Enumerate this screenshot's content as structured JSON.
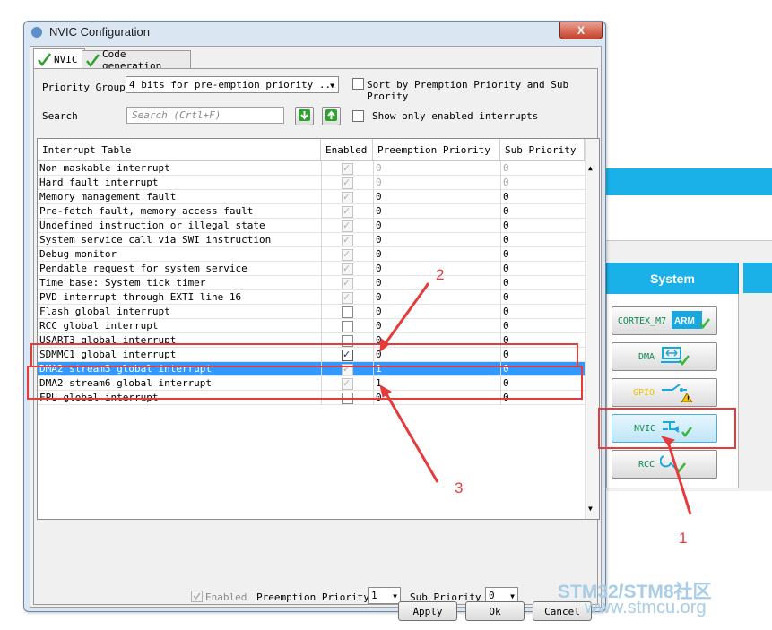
{
  "dialog": {
    "title": "NVIC Configuration",
    "close_label": "X",
    "tabs": [
      {
        "label": "NVIC"
      },
      {
        "label": "Code generation"
      }
    ],
    "priority_group": {
      "label": "Priority Group",
      "value": "4 bits for pre-emption priority ..."
    },
    "sort_checkbox_label": "Sort by Premption Priority and Sub Prority",
    "search": {
      "label": "Search",
      "placeholder": "Search (Crtl+F)"
    },
    "show_enabled_label": "Show only enabled interrupts",
    "table": {
      "headers": [
        "Interrupt Table",
        "Enabled",
        "Preemption Priority",
        "Sub Priority"
      ],
      "rows": [
        {
          "name": "Non maskable interrupt",
          "preemption": "0",
          "sub": "0"
        },
        {
          "name": "Hard fault interrupt",
          "preemption": "0",
          "sub": "0"
        },
        {
          "name": "Memory management fault",
          "preemption": "0",
          "sub": "0"
        },
        {
          "name": "Pre-fetch fault, memory access fault",
          "preemption": "0",
          "sub": "0"
        },
        {
          "name": "Undefined instruction or illegal state",
          "preemption": "0",
          "sub": "0"
        },
        {
          "name": "System service call via SWI instruction",
          "preemption": "0",
          "sub": "0"
        },
        {
          "name": "Debug monitor",
          "preemption": "0",
          "sub": "0"
        },
        {
          "name": "Pendable request for system service",
          "preemption": "0",
          "sub": "0"
        },
        {
          "name": "Time base: System tick timer",
          "preemption": "0",
          "sub": "0"
        },
        {
          "name": "PVD interrupt through EXTI line 16",
          "preemption": "0",
          "sub": "0"
        },
        {
          "name": "Flash global interrupt",
          "preemption": "0",
          "sub": "0"
        },
        {
          "name": "RCC global interrupt",
          "preemption": "0",
          "sub": "0"
        },
        {
          "name": "USART3 global interrupt",
          "preemption": "0",
          "sub": "0"
        },
        {
          "name": "SDMMC1 global interrupt",
          "preemption": "0",
          "sub": "0"
        },
        {
          "name": "DMA2 stream3 global interrupt",
          "preemption": "1",
          "sub": "0"
        },
        {
          "name": "DMA2 stream6 global interrupt",
          "preemption": "1",
          "sub": "0"
        },
        {
          "name": "FPU global interrupt",
          "preemption": "0",
          "sub": "0"
        }
      ]
    },
    "bottom": {
      "enabled_label": "Enabled",
      "preemption_label": "Preemption Priority",
      "preemption_value": "1",
      "sub_label": "Sub Priority",
      "sub_value": "0"
    },
    "buttons": {
      "apply": "Apply",
      "ok": "Ok",
      "cancel": "Cancel"
    }
  },
  "background_panel": {
    "section_title": "System",
    "buttons": [
      {
        "label": "CORTEX_M7",
        "icon": "arm-logo-icon"
      },
      {
        "label": "DMA",
        "icon": "dma-icon"
      },
      {
        "label": "GPIO",
        "icon": "gpio-warning-icon"
      },
      {
        "label": "NVIC",
        "icon": "nvic-icon"
      },
      {
        "label": "RCC",
        "icon": "rcc-icon"
      }
    ],
    "arm_logo_text": "ARM"
  },
  "annotations": {
    "labels": [
      "1",
      "2",
      "3"
    ],
    "color": "#e53b3b"
  },
  "watermark": {
    "line1": "STM32/STM8社区",
    "line2": "www.stmcu.org"
  },
  "colors": {
    "accent": "#19b1e8",
    "selection": "#3399ff",
    "annotation": "#e53b3b"
  }
}
